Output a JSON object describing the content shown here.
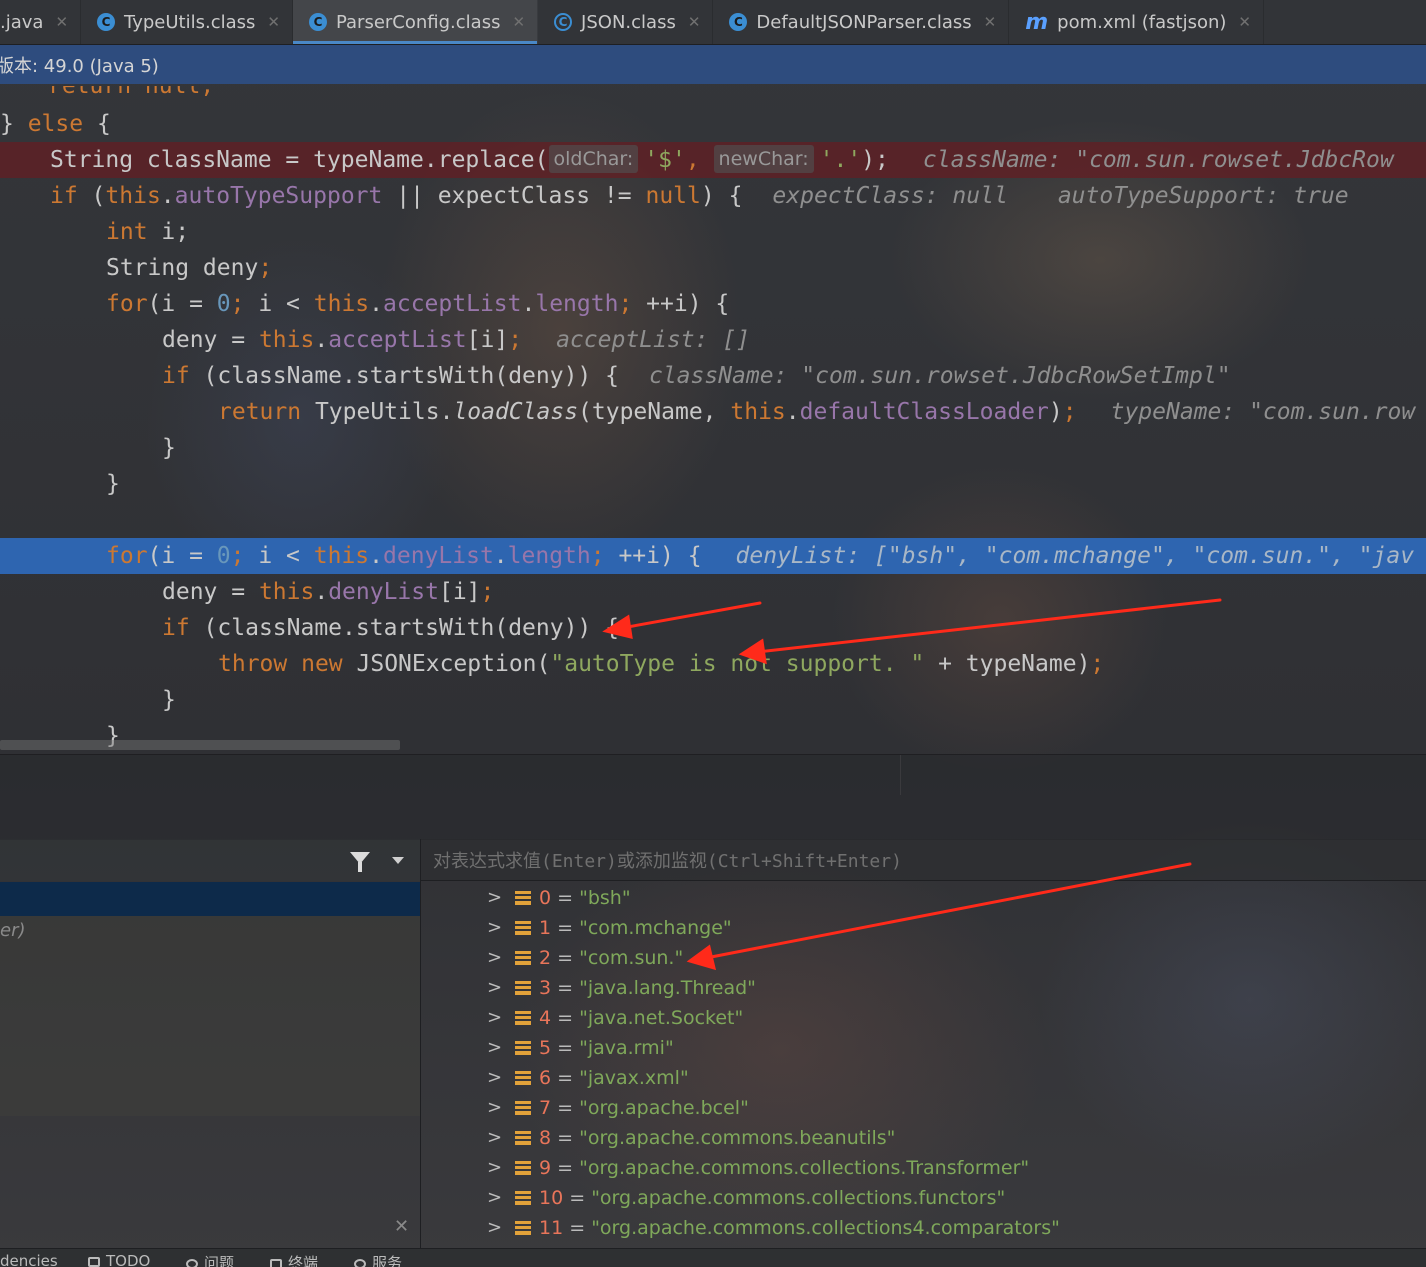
{
  "tabs": [
    {
      "label": ".java",
      "icon": "none",
      "active": false
    },
    {
      "label": "TypeUtils.class",
      "icon": "class-icon",
      "active": false
    },
    {
      "label": "ParserConfig.class",
      "icon": "class-icon",
      "active": true
    },
    {
      "label": "JSON.class",
      "icon": "abstract-class-icon",
      "active": false
    },
    {
      "label": "DefaultJSONParser.class",
      "icon": "class-icon",
      "active": false
    },
    {
      "label": "pom.xml (fastjson)",
      "icon": "maven-icon",
      "active": false
    }
  ],
  "tab_close_glyph": "✕",
  "banner": {
    "text": "版本: 49.0 (Java 5)"
  },
  "code": {
    "l0": "return null;",
    "l1_else": "else",
    "l2_a": "String className = typeName.replace(",
    "l2_hint_old": "oldChar:",
    "l2_old": "'$'",
    "l2_hint_new": "newChar:",
    "l2_new": "'.'",
    "l2_end": ");",
    "l2_inline": "className: \"com.sun.rowset.JdbcRow",
    "l3_if": "if",
    "l3_this": "this",
    "l3_field": "autoTypeSupport",
    "l3_rest": " || expectClass != ",
    "l3_null": "null",
    "l3_close": ") {",
    "l3_inline1": "expectClass: null",
    "l3_inline2": "autoTypeSupport: true",
    "l4_int": "int",
    "l4_rest": " i;",
    "l5_a": "String deny",
    "l5_semi": ";",
    "l6_for": "for",
    "l6_a": "(i = ",
    "l6_zero": "0",
    "l6_b": "; i < ",
    "l6_this": "this",
    "l6_field": "acceptList",
    "l6_dot": ".",
    "l6_len": "length",
    "l6_c": "; ++i) {",
    "l7_a": "deny = ",
    "l7_this": "this",
    "l7_field": "acceptList",
    "l7_b": "[i];",
    "l7_inline": "acceptList: []",
    "l8_if": "if",
    "l8_a": " (className.startsWith(deny)) {",
    "l8_inline": "className: \"com.sun.rowset.JdbcRowSetImpl\"",
    "l9_ret": "return",
    "l9_a": " TypeUtils.",
    "l9_m": "loadClass",
    "l9_b": "(typeName, ",
    "l9_this": "this",
    "l9_field": "defaultClassLoader",
    "l9_c": ");",
    "l9_inline": "typeName: \"com.sun.row",
    "brace": "}",
    "l12_for": "for",
    "l12_a": "(i = ",
    "l12_zero": "0",
    "l12_b": "; i < ",
    "l12_this": "this",
    "l12_field": "denyList",
    "l12_len": "length",
    "l12_c": "; ++i) {",
    "l12_inline": "denyList: [\"bsh\", \"com.mchange\", \"com.sun.\", \"jav",
    "l13_a": "deny = ",
    "l13_this": "this",
    "l13_field": "denyList",
    "l13_b": "[i];",
    "l14_if": "if",
    "l14_a": " (className.startsWith(deny)) {",
    "l15_throw": "throw",
    "l15_new": "new",
    "l15_a": " JSONException(",
    "l15_str": "\"autoType is not support. \"",
    "l15_b": " + typeName)",
    "l15_semi": ";"
  },
  "debugger": {
    "eval_placeholder": "对表达式求值(Enter)或添加监视(Ctrl+Shift+Enter)",
    "frame_partial": "er)",
    "close_glyph": "✕",
    "deny_list": [
      {
        "index": "0",
        "value": "\"bsh\""
      },
      {
        "index": "1",
        "value": "\"com.mchange\""
      },
      {
        "index": "2",
        "value": "\"com.sun.\""
      },
      {
        "index": "3",
        "value": "\"java.lang.Thread\""
      },
      {
        "index": "4",
        "value": "\"java.net.Socket\""
      },
      {
        "index": "5",
        "value": "\"java.rmi\""
      },
      {
        "index": "6",
        "value": "\"javax.xml\""
      },
      {
        "index": "7",
        "value": "\"org.apache.bcel\""
      },
      {
        "index": "8",
        "value": "\"org.apache.commons.beanutils\""
      },
      {
        "index": "9",
        "value": "\"org.apache.commons.collections.Transformer\""
      },
      {
        "index": "10",
        "value": "\"org.apache.commons.collections.functors\""
      },
      {
        "index": "11",
        "value": "\"org.apache.commons.collections4.comparators\""
      }
    ]
  },
  "bottombar": {
    "dependencies": "dencies",
    "todo": "TODO",
    "problems": "问题",
    "terminal": "终端",
    "services": "服务"
  },
  "colors": {
    "keyword": "#cc7832",
    "field": "#9876aa",
    "number": "#6897bb",
    "string": "#8fa85f",
    "breakpoint_line": "#641e23",
    "current_line": "#2e65b0",
    "annotation_arrow": "#ff2a1a"
  }
}
